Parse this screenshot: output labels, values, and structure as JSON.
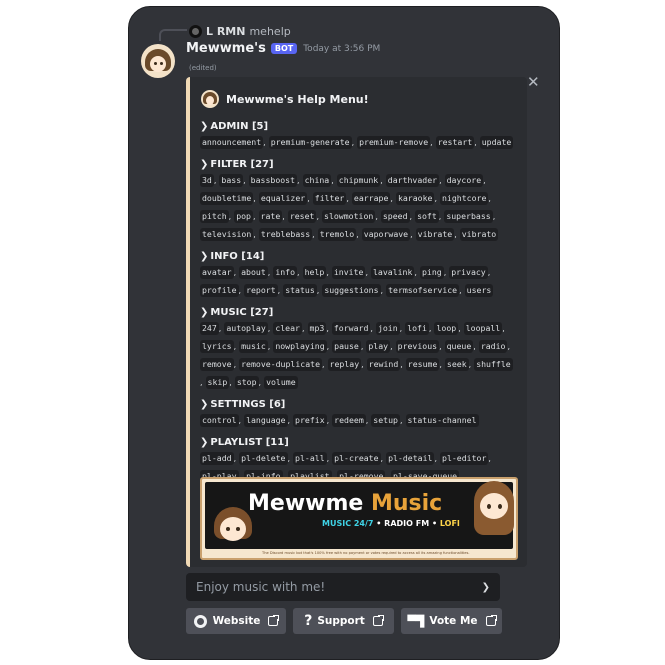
{
  "reply": {
    "name": "L RMN",
    "text": "mehelp"
  },
  "message": {
    "username": "Mewwme's",
    "bot_tag": "BOT",
    "timestamp": "Today at 3:56 PM",
    "edited": "(edited)"
  },
  "embed": {
    "author": "Mewwme's Help Menu!",
    "accent_color": "#f0d9b5",
    "sections": [
      {
        "title": "ADMIN [5]",
        "commands": [
          "announcement",
          "premium-generate",
          "premium-remove",
          "restart",
          "update"
        ]
      },
      {
        "title": "FILTER [27]",
        "commands": [
          "3d",
          "bass",
          "bassboost",
          "china",
          "chipmunk",
          "darthvader",
          "daycore",
          "doubletime",
          "equalizer",
          "filter",
          "earrape",
          "karaoke",
          "nightcore",
          "pitch",
          "pop",
          "rate",
          "reset",
          "slowmotion",
          "speed",
          "soft",
          "superbass",
          "television",
          "treblebass",
          "tremolo",
          "vaporwave",
          "vibrate",
          "vibrato"
        ]
      },
      {
        "title": "INFO [14]",
        "commands": [
          "avatar",
          "about",
          "info",
          "help",
          "invite",
          "lavalink",
          "ping",
          "privacy",
          "profile",
          "report",
          "status",
          "suggestions",
          "termsofservice",
          "users"
        ]
      },
      {
        "title": "MUSIC [27]",
        "commands": [
          "247",
          "autoplay",
          "clear",
          "mp3",
          "forward",
          "join",
          "lofi",
          "loop",
          "loopall",
          "lyrics",
          "music",
          "nowplaying",
          "pause",
          "play",
          "previous",
          "queue",
          "radio",
          "remove",
          "remove-duplicate",
          "replay",
          "rewind",
          "resume",
          "seek",
          "shuffle",
          "skip",
          "stop",
          "volume"
        ]
      },
      {
        "title": "SETTINGS [6]",
        "commands": [
          "control",
          "language",
          "prefix",
          "redeem",
          "setup",
          "status-channel"
        ]
      },
      {
        "title": "PLAYLIST [11]",
        "commands": [
          "pl-add",
          "pl-delete",
          "pl-all",
          "pl-create",
          "pl-detail",
          "pl-editor",
          "pl-play",
          "pl-info",
          "playlist",
          "pl-remove",
          "pl-save-queue"
        ]
      }
    ],
    "banner": {
      "title_white": "Mewwme",
      "title_gold": "Music",
      "sub_a": "MUSIC 24/7",
      "sub_b": "RADIO FM",
      "sub_c": "LOFI",
      "footer": "The Discord music bot that's 100% free with no payment or votes required to access all its amazing functionalities."
    }
  },
  "select": {
    "placeholder": "Enjoy music with me!"
  },
  "buttons": [
    {
      "label": "Website",
      "icon": "website-icon"
    },
    {
      "label": "Support",
      "icon": "question-icon"
    },
    {
      "label": "Vote Me",
      "icon": "topgg-icon"
    }
  ]
}
